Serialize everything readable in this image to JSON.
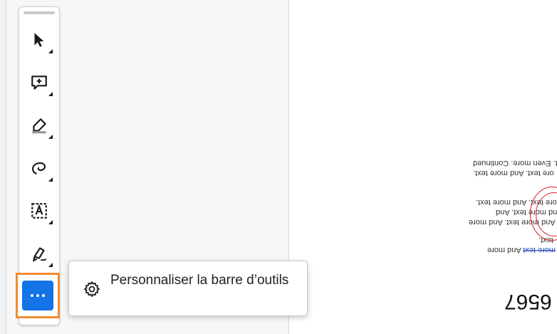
{
  "toolbar": {
    "tools": [
      {
        "icon": "select-arrow-icon"
      },
      {
        "icon": "add-comment-icon"
      },
      {
        "icon": "highlight-pen-icon"
      },
      {
        "icon": "freehand-draw-icon"
      },
      {
        "icon": "text-box-icon"
      },
      {
        "icon": "signature-pen-icon"
      }
    ],
    "more_icon": "more-dots-icon"
  },
  "menu": {
    "items": [
      {
        "icon": "gear-icon",
        "label": "Personnaliser la barre d’outils"
      }
    ]
  },
  "document": {
    "lines": [
      "e text. Even more. Continued",
      "ore text. And more text.",
      "more text. And more text.",
      "ext. And more text. And",
      "ext. And more text. And more",
      "text.",
      "And more",
      "more text"
    ],
    "page_number": "6567"
  },
  "colors": {
    "accent": "#1473e6",
    "focus_outline": "#f28a2e"
  }
}
